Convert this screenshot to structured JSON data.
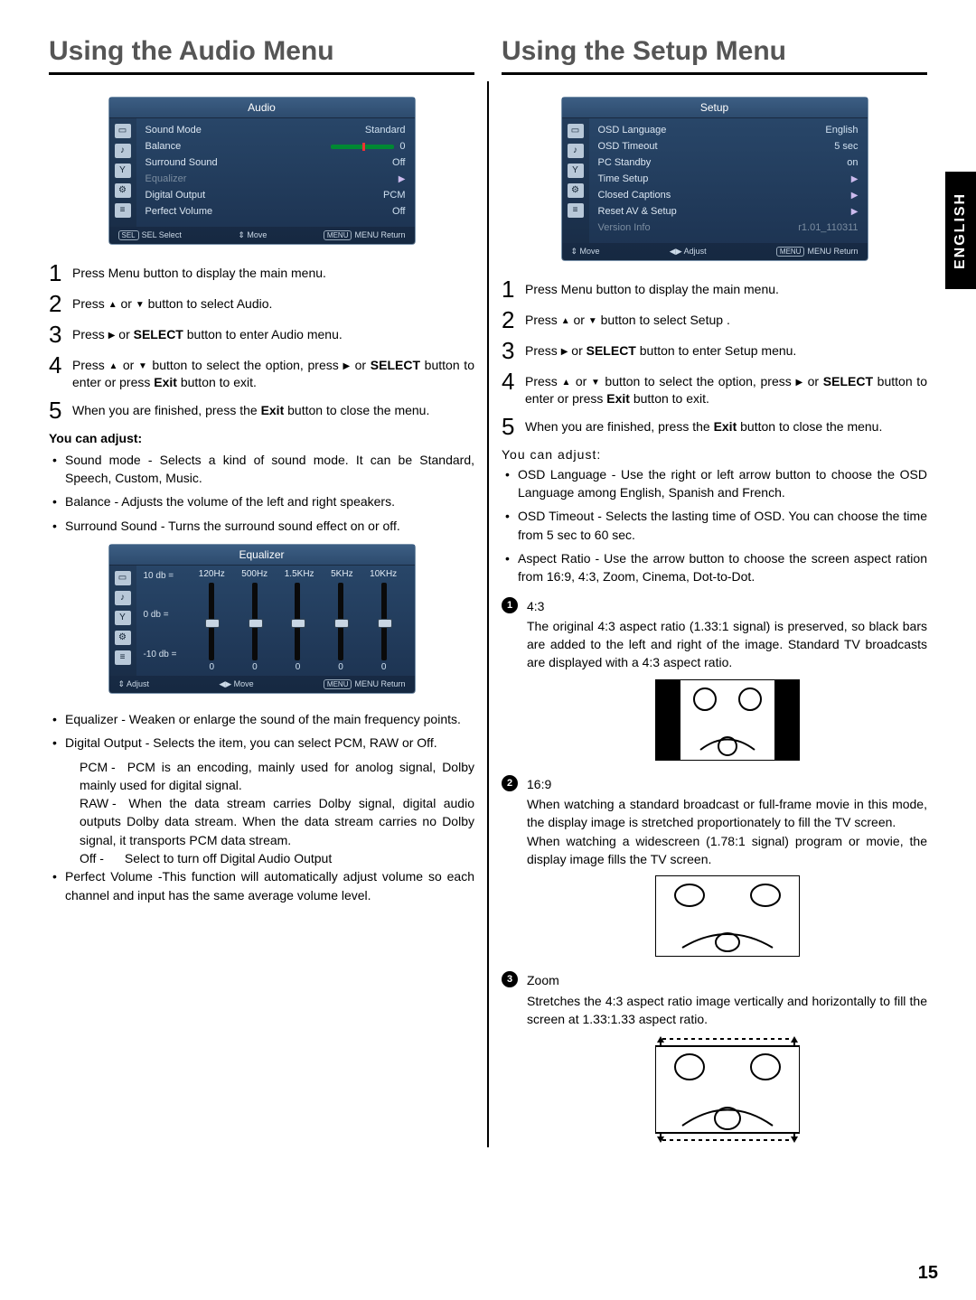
{
  "page_number": "15",
  "side_tab": "ENGLISH",
  "left": {
    "heading": "Using the Audio Menu",
    "osd_audio": {
      "title": "Audio",
      "rows": [
        {
          "label": "Sound Mode",
          "value": "Standard"
        },
        {
          "label": "Balance",
          "value": "0",
          "balance": true
        },
        {
          "label": "Surround Sound",
          "value": "Off"
        },
        {
          "label": "Equalizer",
          "value": "",
          "disabled": true,
          "arrow": true
        },
        {
          "label": "Digital Output",
          "value": "PCM"
        },
        {
          "label": "Perfect Volume",
          "value": "Off"
        }
      ],
      "footer": {
        "a": "SEL  Select",
        "b": "Move",
        "c": "MENU  Return"
      }
    },
    "steps": [
      "Press Menu button to display the main menu.",
      "Press ▲ or ▼ button to select Audio.",
      "Press  ▶ or SELECT button to enter Audio menu.",
      "Press ▲ or ▼ button to select the option, press ▶ or SELECT button to enter or press Exit button to exit.",
      "When you are finished, press the Exit button to close the menu."
    ],
    "adjust_label": "You can adjust:",
    "adjust_top": [
      "Sound mode - Selects a kind of sound mode. It can be Standard, Speech, Custom, Music.",
      "Balance - Adjusts the volume of the left and right speakers.",
      "Surround Sound - Turns the surround sound effect on or off."
    ],
    "osd_eq": {
      "title": "Equalizer",
      "freqs": [
        "120Hz",
        "500Hz",
        "1.5KHz",
        "5KHz",
        "10KHz"
      ],
      "scale": [
        "10 db =",
        "0 db =",
        "-10 db ="
      ],
      "values": [
        "0",
        "0",
        "0",
        "0",
        "0"
      ],
      "footer": {
        "a": "Adjust",
        "b": "Move",
        "c": "MENU  Return"
      }
    },
    "adjust_bottom": [
      "Equalizer - Weaken or enlarge the sound of the main frequency points.",
      "Digital Output - Selects the item, you can select PCM, RAW or Off."
    ],
    "digital_sub": [
      {
        "k": "PCM -",
        "v": "PCM is an encoding, mainly used for anolog signal, Dolby mainly used for digital signal."
      },
      {
        "k": "RAW -",
        "v": "When the data stream carries Dolby signal, digital audio outputs Dolby data stream. When the data stream carries no Dolby signal, it transports PCM data stream."
      },
      {
        "k": "Off  -",
        "v": "Select to turn off Digital Audio Output"
      }
    ],
    "adjust_last": "Perfect Volume  -This function will automatically adjust volume so each channel and input has the same average volume level."
  },
  "right": {
    "heading": "Using the Setup Menu",
    "osd_setup": {
      "title": "Setup",
      "rows": [
        {
          "label": "OSD Language",
          "value": "English"
        },
        {
          "label": "OSD Timeout",
          "value": "5 sec"
        },
        {
          "label": "PC Standby",
          "value": "on"
        },
        {
          "label": "Time Setup",
          "value": "",
          "arrow": true
        },
        {
          "label": "Closed Captions",
          "value": "",
          "arrow": true
        },
        {
          "label": "Reset AV & Setup",
          "value": "",
          "arrow": true
        },
        {
          "label": "Version  Info",
          "value": "r1.01_110311",
          "disabled": true
        }
      ],
      "footer": {
        "a": "Move",
        "b": "Adjust",
        "c": "MENU  Return"
      }
    },
    "steps": [
      "Press Menu button to display the main menu.",
      "Press ▲ or ▼ button to select Setup .",
      "Press  ▶ or SELECT button to enter Setup menu.",
      "Press ▲ or ▼ button to select the option, press ▶ or SELECT button to enter or press Exit button to exit.",
      "When you are finished, press the Exit button to close the menu."
    ],
    "adjust_label": "You can adjust:",
    "adjust": [
      "OSD Language - Use the right or left arrow button to choose the OSD Language among English, Spanish and French.",
      "OSD Timeout - Selects the lasting time of OSD. You can choose the time from 5 sec to 60 sec.",
      "Aspect Ratio - Use the arrow button to choose the screen aspect ration from 16:9, 4:3, Zoom, Cinema, Dot-to-Dot."
    ],
    "aspects": [
      {
        "num": "1",
        "title": "4:3",
        "body": "The original 4:3 aspect ratio (1.33:1 signal) is preserved, so black bars are added to the left and right of the image. Standard TV broadcasts are displayed with a 4:3 aspect ratio.",
        "diagram": "4_3"
      },
      {
        "num": "2",
        "title": "16:9",
        "body": "When watching a standard broadcast or full-frame movie in this mode, the display image is stretched proportionately to fill the TV screen.\nWhen watching a widescreen (1.78:1 signal) program or movie, the display image fills the TV screen.",
        "diagram": "16_9"
      },
      {
        "num": "3",
        "title": "Zoom",
        "body": "Stretches the 4:3 aspect ratio image vertically and horizontally to fill the screen at 1.33:1.33 aspect ratio.",
        "diagram": "zoom"
      }
    ]
  }
}
